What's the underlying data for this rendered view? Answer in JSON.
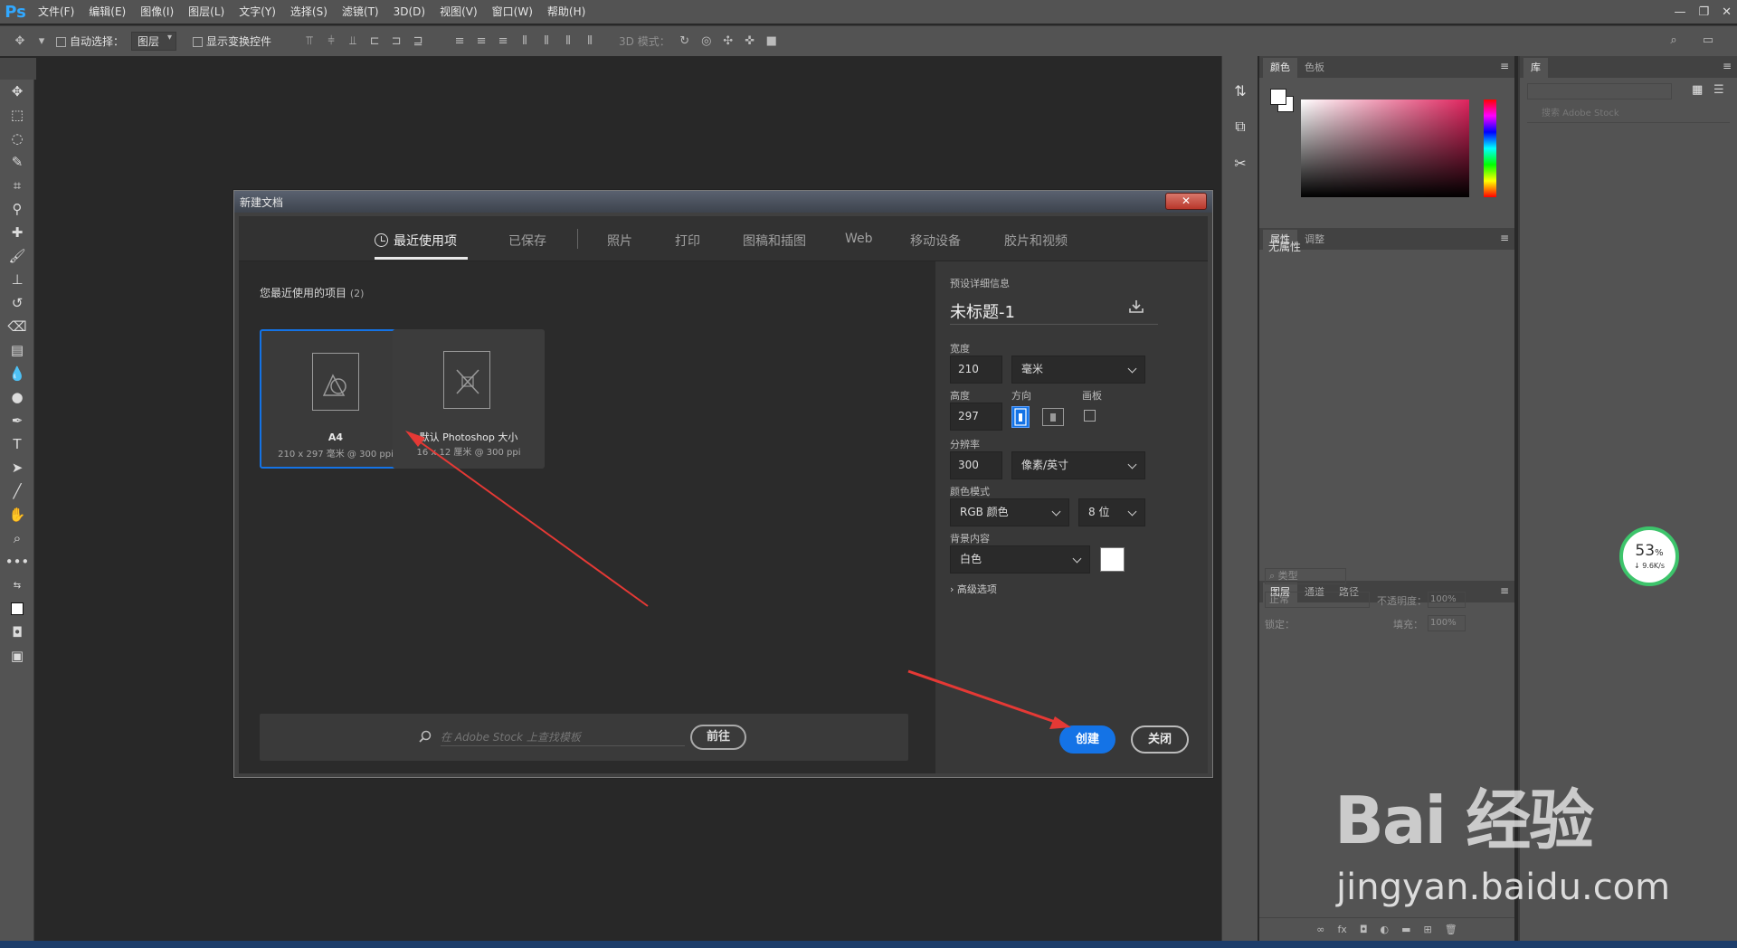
{
  "app": {
    "logo": "Ps",
    "menu": [
      "文件(F)",
      "编辑(E)",
      "图像(I)",
      "图层(L)",
      "文字(Y)",
      "选择(S)",
      "滤镜(T)",
      "3D(D)",
      "视图(V)",
      "窗口(W)",
      "帮助(H)"
    ],
    "window_controls": [
      "—",
      "❐",
      "✕"
    ]
  },
  "options_bar": {
    "auto_select_label": "自动选择：",
    "auto_select_value": "图层",
    "show_transform_label": "显示变换控件",
    "mode_3d_label": "3D 模式："
  },
  "panels": {
    "color_tabs": [
      "颜色",
      "色板"
    ],
    "props_tabs": [
      "属性",
      "调整"
    ],
    "no_props": "无属性",
    "layers_tabs": [
      "图层",
      "通道",
      "路径"
    ],
    "layers_filter": "类型",
    "blend_mode": "正常",
    "opacity_label": "不透明度：",
    "opacity_value": "100%",
    "lock_label": "锁定：",
    "fill_label": "填充：",
    "fill_value": "100%",
    "library_tab": "库",
    "library_search_placeholder": "搜索 Adobe Stock"
  },
  "dialog": {
    "title": "新建文档",
    "close_glyph": "✕",
    "tabs": [
      {
        "label": "最近使用项",
        "active": true
      },
      {
        "label": "已保存"
      },
      {
        "label": "照片"
      },
      {
        "label": "打印"
      },
      {
        "label": "图稿和插图"
      },
      {
        "label": "Web"
      },
      {
        "label": "移动设备"
      },
      {
        "label": "胶片和视频"
      }
    ],
    "recent_label": "您最近使用的项目",
    "recent_count": "(2)",
    "cards": [
      {
        "name": "A4",
        "sub": "210 x 297 毫米 @ 300 ppi",
        "selected": true
      },
      {
        "name": "默认 Photoshop 大小",
        "sub": "16 x 12 厘米 @ 300 ppi"
      }
    ],
    "stock_placeholder": "在 Adobe Stock 上查找模板",
    "goto_label": "前往",
    "details": {
      "heading": "预设详细信息",
      "name": "未标题-1",
      "width_label": "宽度",
      "width_value": "210",
      "width_unit": "毫米",
      "height_label": "高度",
      "height_value": "297",
      "orientation_label": "方向",
      "artboard_label": "画板",
      "resolution_label": "分辨率",
      "resolution_value": "300",
      "resolution_unit": "像素/英寸",
      "color_mode_label": "颜色模式",
      "color_mode": "RGB 颜色",
      "bit_depth": "8 位",
      "background_label": "背景内容",
      "background": "白色",
      "advanced_label": "高级选项"
    },
    "create_label": "创建",
    "close_label": "关闭"
  },
  "speed_widget": {
    "percent": "53",
    "percent_sign": "%",
    "rate": "↓ 9.6K/s"
  },
  "watermark": {
    "text": "Bai 经验",
    "url": "jingyan.baidu.com"
  },
  "colors": {
    "accent": "#1473e6",
    "annotation": "#e53935",
    "speed_ring": "#3dc46b"
  }
}
